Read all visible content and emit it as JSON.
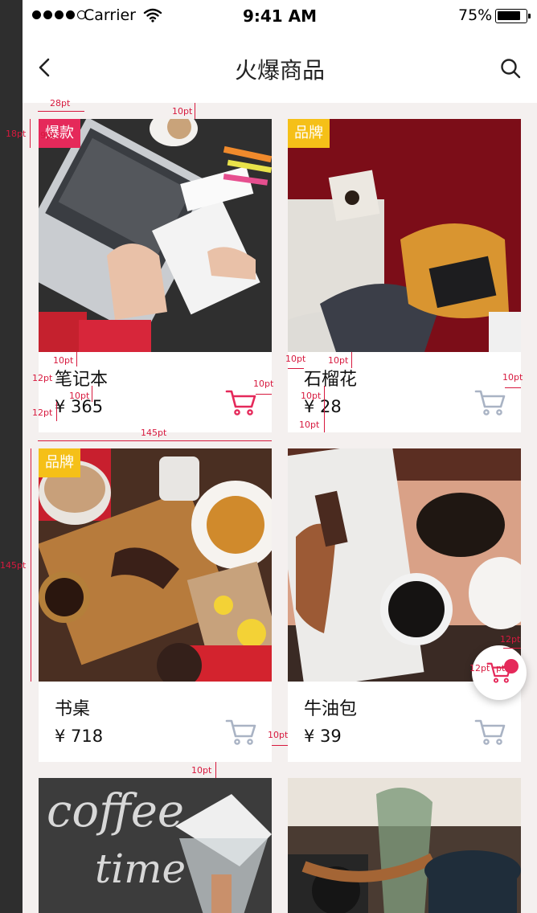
{
  "status_bar": {
    "carrier": "Carrier",
    "time": "9:41 AM",
    "battery": "75%",
    "battery_level": 0.75
  },
  "navbar": {
    "title": "火爆商品",
    "back_icon": "chevron-left-icon",
    "search_icon": "search-icon"
  },
  "colors": {
    "accent": "#e5295a",
    "tag_yellow": "#f5c018",
    "background": "#f4f0ef",
    "cart_inactive": "#a9b3c4"
  },
  "products": [
    {
      "tag": "爆款",
      "tag_color": "red",
      "name": "笔记本",
      "price": "¥ 365",
      "cart_active": true
    },
    {
      "tag": "品牌",
      "tag_color": "yellow",
      "name": "石榴花",
      "price": "¥ 28",
      "cart_active": false
    },
    {
      "tag": "品牌",
      "tag_color": "yellow",
      "name": "书桌",
      "price": "¥ 718",
      "cart_active": false
    },
    {
      "tag": "",
      "tag_color": "",
      "name": "牛油包",
      "price": "¥ 39",
      "cart_active": false
    },
    {
      "tag": "",
      "tag_color": "",
      "name": "",
      "price": "",
      "cart_active": false
    },
    {
      "tag": "",
      "tag_color": "",
      "name": "",
      "price": "",
      "cart_active": false
    }
  ],
  "annotations": {
    "a1": "28pt",
    "a2": "10pt",
    "a3": "18pt",
    "a4": "9pt",
    "a5": "10pt",
    "a6": "12pt",
    "a7": "10pt",
    "a8": "12pt",
    "a9": "10pt",
    "a10": "10pt",
    "a11": "10pt",
    "a12": "10pt",
    "a13": "10pt",
    "a14": "10pt",
    "a15": "145pt",
    "a16": "145pt",
    "a17": "12pt",
    "a18": "12pt",
    "a19": "pt",
    "a20": "10pt",
    "a21": "10pt"
  }
}
